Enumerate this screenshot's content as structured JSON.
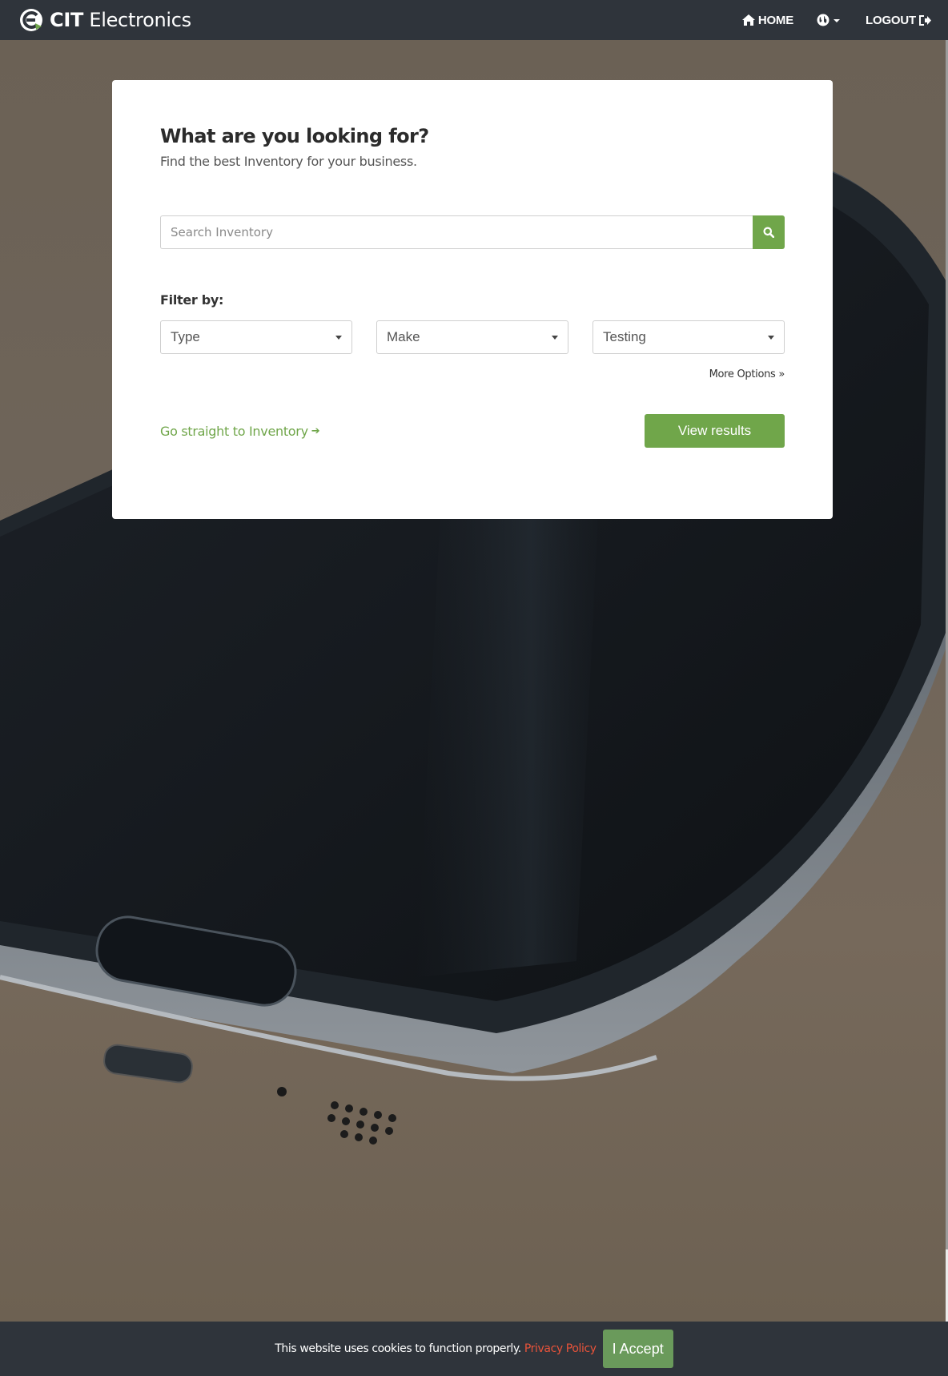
{
  "brand": {
    "bold": "CIT",
    "name": " Electronics"
  },
  "nav": {
    "home": "HOME",
    "logout": "LOGOUT"
  },
  "panel": {
    "title": "What are you looking for?",
    "subtitle": "Find the best Inventory for your business.",
    "search_placeholder": "Search Inventory",
    "filter_label": "Filter by:",
    "filters": [
      {
        "label": "Type"
      },
      {
        "label": "Make"
      },
      {
        "label": "Testing"
      }
    ],
    "more_options": "More Options »",
    "go_link": "Go straight to Inventory",
    "go_arrow": "➔",
    "view_button": "View results"
  },
  "cookie": {
    "message": "This website uses cookies to function properly.",
    "policy": "Privacy Policy",
    "accept": "I Accept"
  },
  "colors": {
    "accent": "#70a64a",
    "navbar": "#2f343b",
    "policy_link": "#e8533a"
  },
  "icons": [
    "cit-logo-icon",
    "home-icon",
    "globe-icon",
    "logout-icon",
    "search-icon"
  ]
}
